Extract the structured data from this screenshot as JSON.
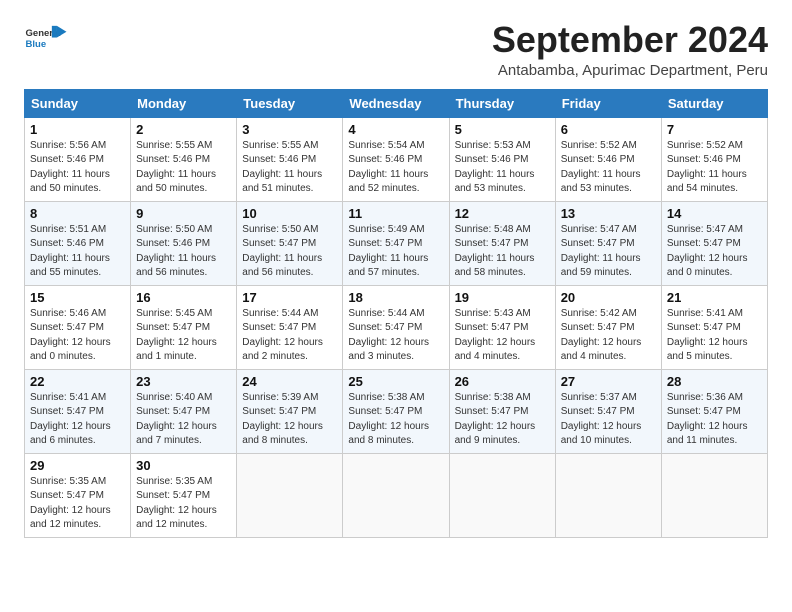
{
  "header": {
    "logo_general": "General",
    "logo_blue": "Blue",
    "month_title": "September 2024",
    "subtitle": "Antabamba, Apurimac Department, Peru"
  },
  "weekdays": [
    "Sunday",
    "Monday",
    "Tuesday",
    "Wednesday",
    "Thursday",
    "Friday",
    "Saturday"
  ],
  "weeks": [
    [
      {
        "day": "1",
        "sunrise": "5:56 AM",
        "sunset": "5:46 PM",
        "daylight": "11 hours and 50 minutes."
      },
      {
        "day": "2",
        "sunrise": "5:55 AM",
        "sunset": "5:46 PM",
        "daylight": "11 hours and 50 minutes."
      },
      {
        "day": "3",
        "sunrise": "5:55 AM",
        "sunset": "5:46 PM",
        "daylight": "11 hours and 51 minutes."
      },
      {
        "day": "4",
        "sunrise": "5:54 AM",
        "sunset": "5:46 PM",
        "daylight": "11 hours and 52 minutes."
      },
      {
        "day": "5",
        "sunrise": "5:53 AM",
        "sunset": "5:46 PM",
        "daylight": "11 hours and 53 minutes."
      },
      {
        "day": "6",
        "sunrise": "5:52 AM",
        "sunset": "5:46 PM",
        "daylight": "11 hours and 53 minutes."
      },
      {
        "day": "7",
        "sunrise": "5:52 AM",
        "sunset": "5:46 PM",
        "daylight": "11 hours and 54 minutes."
      }
    ],
    [
      {
        "day": "8",
        "sunrise": "5:51 AM",
        "sunset": "5:46 PM",
        "daylight": "11 hours and 55 minutes."
      },
      {
        "day": "9",
        "sunrise": "5:50 AM",
        "sunset": "5:46 PM",
        "daylight": "11 hours and 56 minutes."
      },
      {
        "day": "10",
        "sunrise": "5:50 AM",
        "sunset": "5:47 PM",
        "daylight": "11 hours and 56 minutes."
      },
      {
        "day": "11",
        "sunrise": "5:49 AM",
        "sunset": "5:47 PM",
        "daylight": "11 hours and 57 minutes."
      },
      {
        "day": "12",
        "sunrise": "5:48 AM",
        "sunset": "5:47 PM",
        "daylight": "11 hours and 58 minutes."
      },
      {
        "day": "13",
        "sunrise": "5:47 AM",
        "sunset": "5:47 PM",
        "daylight": "11 hours and 59 minutes."
      },
      {
        "day": "14",
        "sunrise": "5:47 AM",
        "sunset": "5:47 PM",
        "daylight": "12 hours and 0 minutes."
      }
    ],
    [
      {
        "day": "15",
        "sunrise": "5:46 AM",
        "sunset": "5:47 PM",
        "daylight": "12 hours and 0 minutes."
      },
      {
        "day": "16",
        "sunrise": "5:45 AM",
        "sunset": "5:47 PM",
        "daylight": "12 hours and 1 minute."
      },
      {
        "day": "17",
        "sunrise": "5:44 AM",
        "sunset": "5:47 PM",
        "daylight": "12 hours and 2 minutes."
      },
      {
        "day": "18",
        "sunrise": "5:44 AM",
        "sunset": "5:47 PM",
        "daylight": "12 hours and 3 minutes."
      },
      {
        "day": "19",
        "sunrise": "5:43 AM",
        "sunset": "5:47 PM",
        "daylight": "12 hours and 4 minutes."
      },
      {
        "day": "20",
        "sunrise": "5:42 AM",
        "sunset": "5:47 PM",
        "daylight": "12 hours and 4 minutes."
      },
      {
        "day": "21",
        "sunrise": "5:41 AM",
        "sunset": "5:47 PM",
        "daylight": "12 hours and 5 minutes."
      }
    ],
    [
      {
        "day": "22",
        "sunrise": "5:41 AM",
        "sunset": "5:47 PM",
        "daylight": "12 hours and 6 minutes."
      },
      {
        "day": "23",
        "sunrise": "5:40 AM",
        "sunset": "5:47 PM",
        "daylight": "12 hours and 7 minutes."
      },
      {
        "day": "24",
        "sunrise": "5:39 AM",
        "sunset": "5:47 PM",
        "daylight": "12 hours and 8 minutes."
      },
      {
        "day": "25",
        "sunrise": "5:38 AM",
        "sunset": "5:47 PM",
        "daylight": "12 hours and 8 minutes."
      },
      {
        "day": "26",
        "sunrise": "5:38 AM",
        "sunset": "5:47 PM",
        "daylight": "12 hours and 9 minutes."
      },
      {
        "day": "27",
        "sunrise": "5:37 AM",
        "sunset": "5:47 PM",
        "daylight": "12 hours and 10 minutes."
      },
      {
        "day": "28",
        "sunrise": "5:36 AM",
        "sunset": "5:47 PM",
        "daylight": "12 hours and 11 minutes."
      }
    ],
    [
      {
        "day": "29",
        "sunrise": "5:35 AM",
        "sunset": "5:47 PM",
        "daylight": "12 hours and 12 minutes."
      },
      {
        "day": "30",
        "sunrise": "5:35 AM",
        "sunset": "5:47 PM",
        "daylight": "12 hours and 12 minutes."
      },
      null,
      null,
      null,
      null,
      null
    ]
  ],
  "labels": {
    "sunrise": "Sunrise:",
    "sunset": "Sunset:",
    "daylight": "Daylight:"
  }
}
